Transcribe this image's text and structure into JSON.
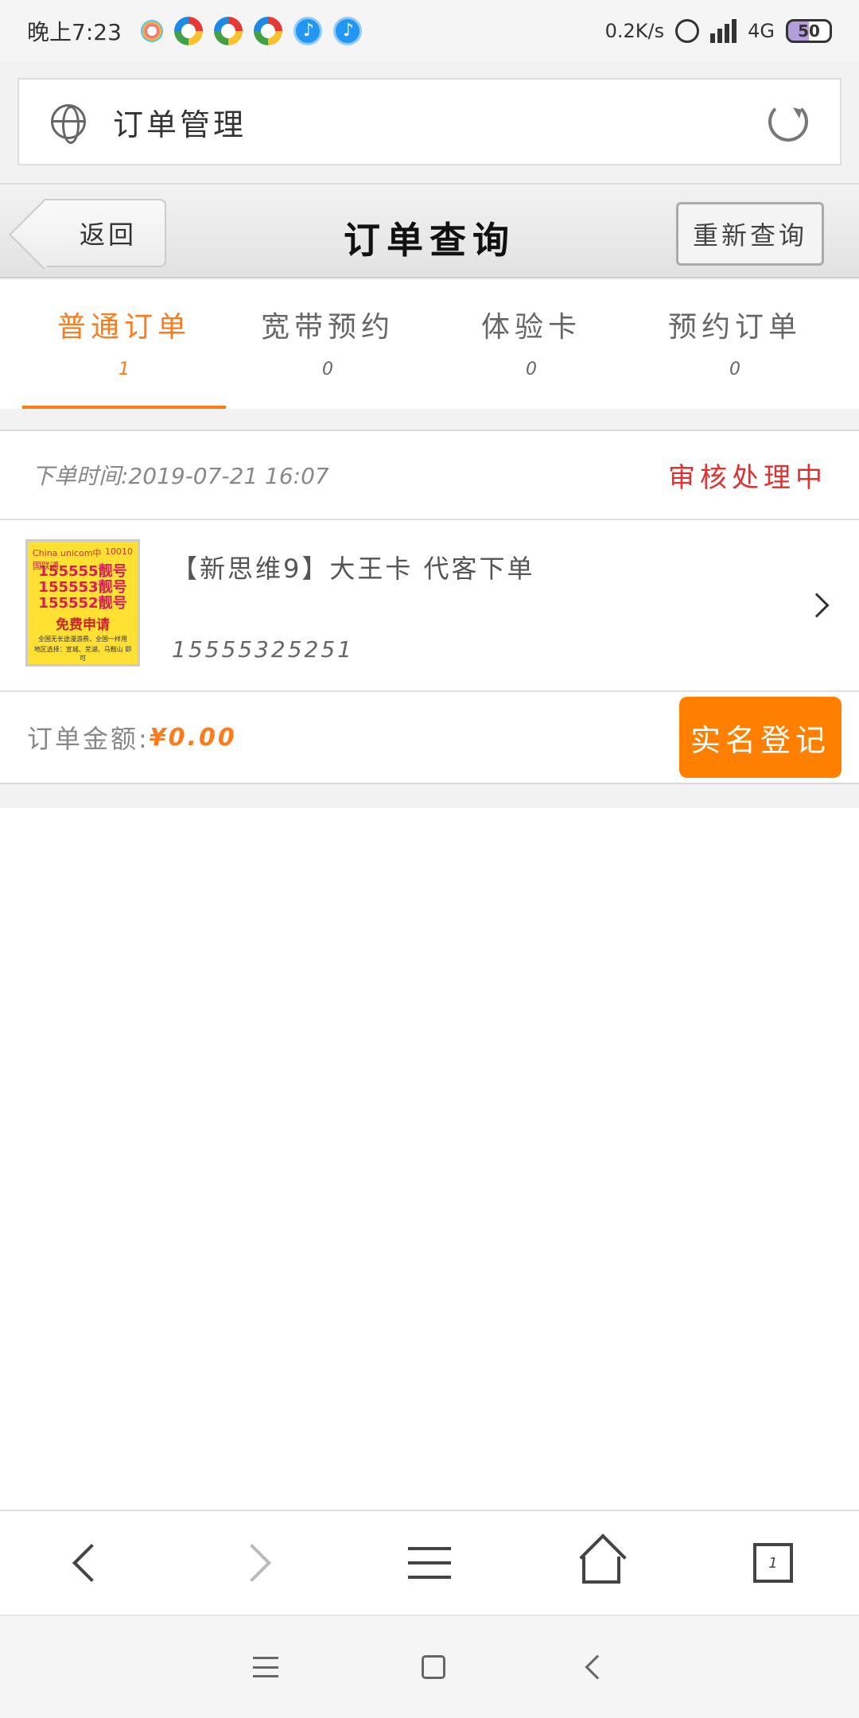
{
  "status_bar": {
    "time": "晚上7:23",
    "network_speed": "0.2K/s",
    "network_type": "4G",
    "battery": "50"
  },
  "address_bar": {
    "title": "订单管理"
  },
  "header": {
    "back_label": "返回",
    "title": "订单查询",
    "requery_label": "重新查询"
  },
  "tabs": [
    {
      "label": "普通订单",
      "count": "1",
      "active": true
    },
    {
      "label": "宽带预约",
      "count": "0",
      "active": false
    },
    {
      "label": "体验卡",
      "count": "0",
      "active": false
    },
    {
      "label": "预约订单",
      "count": "0",
      "active": false
    }
  ],
  "order": {
    "time": "下单时间:2019-07-21  16:07",
    "status": "审核处理中",
    "product_name": "【新思维9】大王卡 代客下单",
    "phone": "15555325251",
    "amount_label": "订单金额:",
    "amount_value": "¥0.00",
    "realname_button": "实名登记",
    "thumbnail": {
      "brand_left": "China unicom中国联通",
      "brand_right": "10010",
      "lines": [
        "155555靓号",
        "155553靓号",
        "155552靓号"
      ],
      "apply": "免费申请",
      "note1": "全国无长途漫游费，全国一样用",
      "note2": "地区选择：宣城、芜湖、马鞍山 即可"
    }
  },
  "browser_toolbar": {
    "tab_count": "1"
  },
  "colors": {
    "accent": "#ff7a1a",
    "status_red": "#e03030",
    "button_orange": "#ff7f00"
  }
}
